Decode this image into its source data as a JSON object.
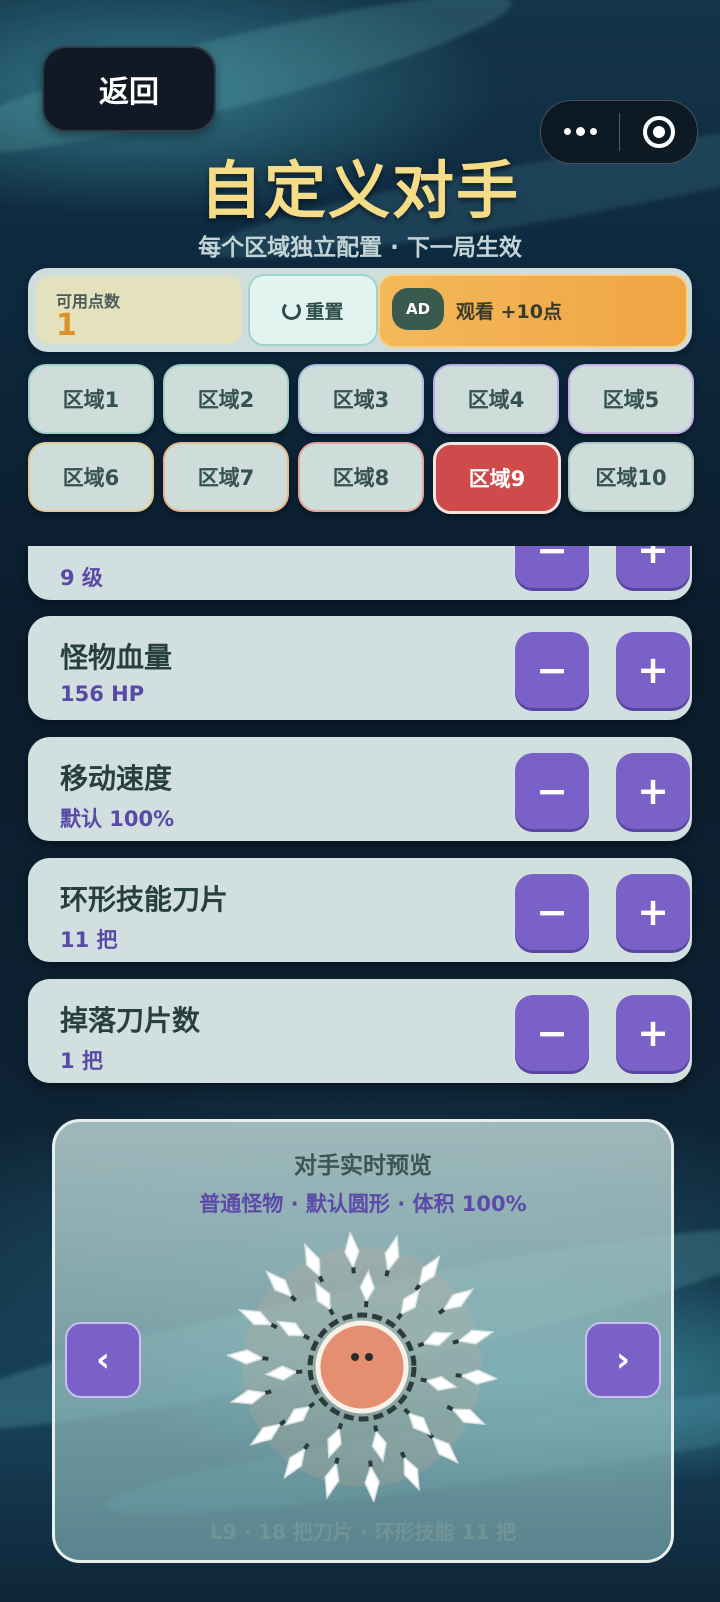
{
  "header": {
    "back_label": "返回",
    "title": "自定义对手",
    "subtitle": "每个区域独立配置 · 下一局生效"
  },
  "points": {
    "label": "可用点数",
    "value": "1",
    "reset_label": "重置",
    "ad_badge": "AD",
    "ad_label": "观看 +10点"
  },
  "zones": [
    {
      "label": "区域1",
      "border": "#9fd1c4"
    },
    {
      "label": "区域2",
      "border": "#9fd1c4"
    },
    {
      "label": "区域3",
      "border": "#a7bfe0"
    },
    {
      "label": "区域4",
      "border": "#b7aee2"
    },
    {
      "label": "区域5",
      "border": "#c5b0e6"
    },
    {
      "label": "区域6",
      "border": "#e1c98f"
    },
    {
      "label": "区域7",
      "border": "#e7b88a"
    },
    {
      "label": "区域8",
      "border": "#e3a4a0"
    },
    {
      "label": "区域9",
      "border": "#f5e7e0"
    },
    {
      "label": "区域10",
      "border": "#a9c8c2"
    }
  ],
  "active_zone": "区域9",
  "settings": [
    {
      "name": "",
      "value": "9 级"
    },
    {
      "name": "怪物血量",
      "value": "156 HP"
    },
    {
      "name": "移动速度",
      "value": "默认 100%"
    },
    {
      "name": "环形技能刀片",
      "value": "11 把"
    },
    {
      "name": "掉落刀片数",
      "value": "1 把"
    }
  ],
  "stepper": {
    "minus": "−",
    "plus": "+"
  },
  "preview": {
    "title": "对手实时预览",
    "subtitle": "普通怪物 · 默认圆形 · 体积 100%",
    "prev_label": "‹",
    "next_label": "›",
    "footer": "L9 · 18 把刀片 · 环形技能 11 把"
  },
  "colors": {
    "accent": "#7a61c7",
    "active_zone": "#cf4b4b",
    "title": "#f5dc86",
    "monster_body": "#e58f72"
  }
}
